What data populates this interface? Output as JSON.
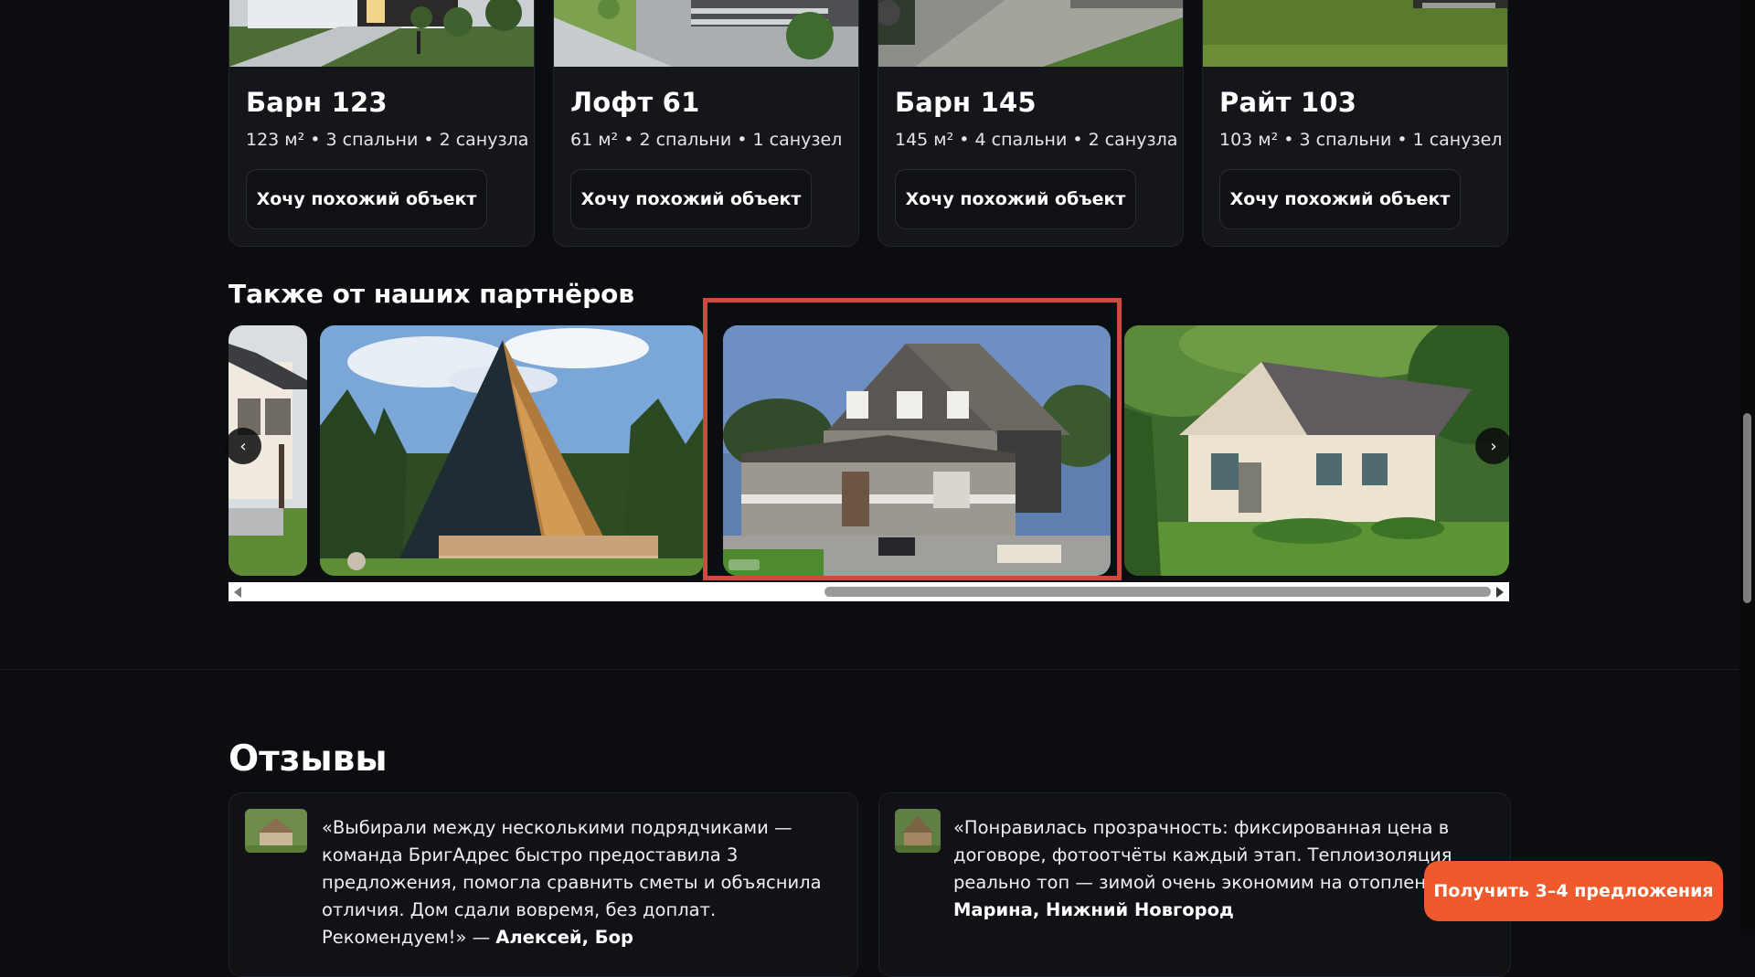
{
  "projects": [
    {
      "title": "Барн 123",
      "meta": "123 м² • 3 спальни • 2 санузла",
      "button": "Хочу похожий объект"
    },
    {
      "title": "Лофт 61",
      "meta": "61 м² • 2 спальни • 1 санузел",
      "button": "Хочу похожий объект"
    },
    {
      "title": "Барн 145",
      "meta": "145 м² • 4 спальни • 2 санузла",
      "button": "Хочу похожий объект"
    },
    {
      "title": "Райт 103",
      "meta": "103 м² • 3 спальни • 1 санузел",
      "button": "Хочу похожий объект"
    }
  ],
  "partners": {
    "title": "Также от наших партнёров",
    "prev_label": "‹",
    "next_label": "›"
  },
  "reviews": {
    "title": "Отзывы",
    "items": [
      {
        "text": "«Выбирали между несколькими подрядчиками — команда БригАдрес быстро предоставила 3 предложения, помогла сравнить сметы и объяснила отличия. Дом сдали вовремя, без доплат. Рекомендуем!» — ",
        "author": "Алексей, Бор"
      },
      {
        "text": "«Понравилась прозрачность: фиксированная цена в договоре, фотоотчёты каждый этап. Теплоизоляция реально топ — зимой очень экономим на отоплении.» — ",
        "author": "Марина, Нижний Новгород"
      }
    ]
  },
  "cta": {
    "label": "Получить 3–4 предложения"
  },
  "colors": {
    "background": "#0c0d11",
    "card": "#15161b",
    "accent": "#ef5a2c",
    "highlight": "#d2483f"
  }
}
